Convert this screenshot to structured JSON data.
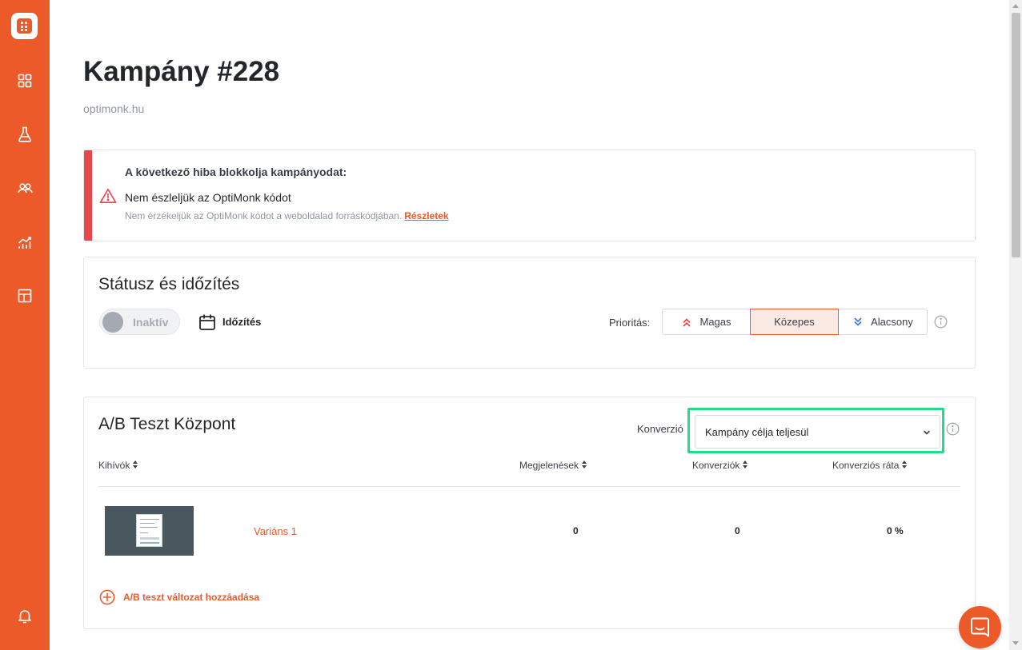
{
  "brand": {
    "accent": "#ed5a29",
    "error": "#e5484d",
    "highlight": "#1fdf84"
  },
  "sidebar": {
    "logo": "optimonk-logo",
    "items": [
      {
        "icon": "dashboard-grid-icon"
      },
      {
        "icon": "flask-icon"
      },
      {
        "icon": "users-icon"
      },
      {
        "icon": "analytics-chart-icon"
      },
      {
        "icon": "layout-template-icon"
      }
    ],
    "bottom": [
      {
        "icon": "bell-icon"
      }
    ]
  },
  "header": {
    "title": "Kampány #228",
    "domain": "optimonk.hu"
  },
  "alert": {
    "title": "A következő hiba blokkolja kampányodat:",
    "message": "Nem észleljük az OptiMonk kódot",
    "description": "Nem érzékeljük az OptiMonk kódot a weboldalad forráskódjában.",
    "link": "Részletek"
  },
  "status": {
    "title": "Státusz és időzítés",
    "toggle_label": "Inaktív",
    "toggle_on": false,
    "schedule_label": "Időzítés",
    "priority_label": "Prioritás:",
    "priorities": [
      {
        "label": "Magas",
        "icon": "chevrons-up-icon",
        "active": false
      },
      {
        "label": "Közepes",
        "icon": "",
        "active": true
      },
      {
        "label": "Alacsony",
        "icon": "chevrons-down-icon",
        "active": false
      }
    ]
  },
  "ab_test": {
    "title": "A/B Teszt Központ",
    "conversion_label": "Konverzió",
    "conversion_value": "Kampány célja teljesül",
    "columns": {
      "challengers": "Kihívók",
      "impressions": "Megjelenések",
      "conversions": "Konverziók",
      "rate": "Konverziós ráta"
    },
    "rows": [
      {
        "name": "Variáns 1",
        "impressions": "0",
        "conversions": "0",
        "rate": "0 %"
      }
    ],
    "add_variant": "A/B teszt változat hozzáadása"
  },
  "chat": {
    "icon": "chat-icon"
  }
}
